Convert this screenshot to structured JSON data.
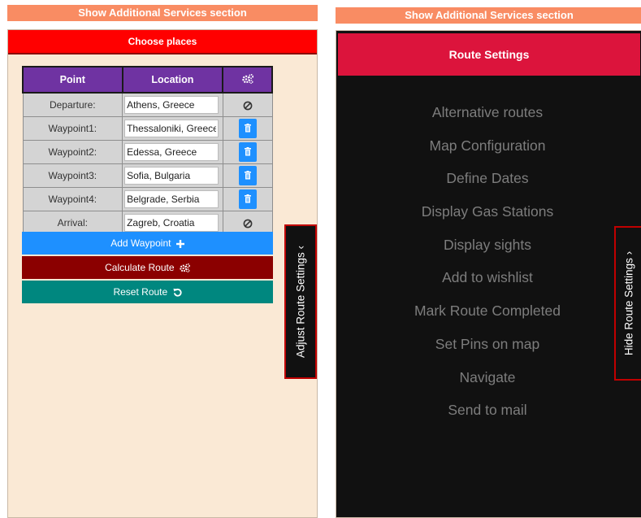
{
  "banners": {
    "left": "Show Additional Services section",
    "right": "Show Additional Services section"
  },
  "left_panel": {
    "header": "Choose places",
    "table": {
      "headers": {
        "point": "Point",
        "location": "Location",
        "actions_icon": "gears-icon"
      },
      "rows": [
        {
          "point": "Departure:",
          "location": "Athens, Greece",
          "action": "block-icon"
        },
        {
          "point": "Waypoint1:",
          "location": "Thessaloniki, Greece",
          "action": "trash-icon"
        },
        {
          "point": "Waypoint2:",
          "location": "Edessa, Greece",
          "action": "trash-icon"
        },
        {
          "point": "Waypoint3:",
          "location": "Sofia, Bulgaria",
          "action": "trash-icon"
        },
        {
          "point": "Waypoint4:",
          "location": "Belgrade, Serbia",
          "action": "trash-icon"
        },
        {
          "point": "Arrival:",
          "location": "Zagreb, Croatia",
          "action": "block-icon"
        }
      ]
    },
    "buttons": {
      "add": "Add Waypoint",
      "calculate": "Calculate Route",
      "reset": "Reset Route"
    },
    "side_tab": "Adjust Route Settings ‹"
  },
  "right_panel": {
    "header": "Route Settings",
    "menu": [
      "Alternative routes",
      "Map Configuration",
      "Define Dates",
      "Display Gas Stations",
      "Display sights",
      "Add to wishlist",
      "Mark Route Completed",
      "Set Pins on map",
      "Navigate",
      "Send to mail"
    ],
    "side_tab": "Hide Route Settings ›"
  },
  "colors": {
    "banner": "#f98c63",
    "left_header": "#ff0000",
    "table_header": "#6f33a2",
    "add_button": "#1e90ff",
    "calculate_button": "#8b0000",
    "reset_button": "#00877f",
    "right_header": "#dc143c",
    "right_background": "#111111"
  }
}
